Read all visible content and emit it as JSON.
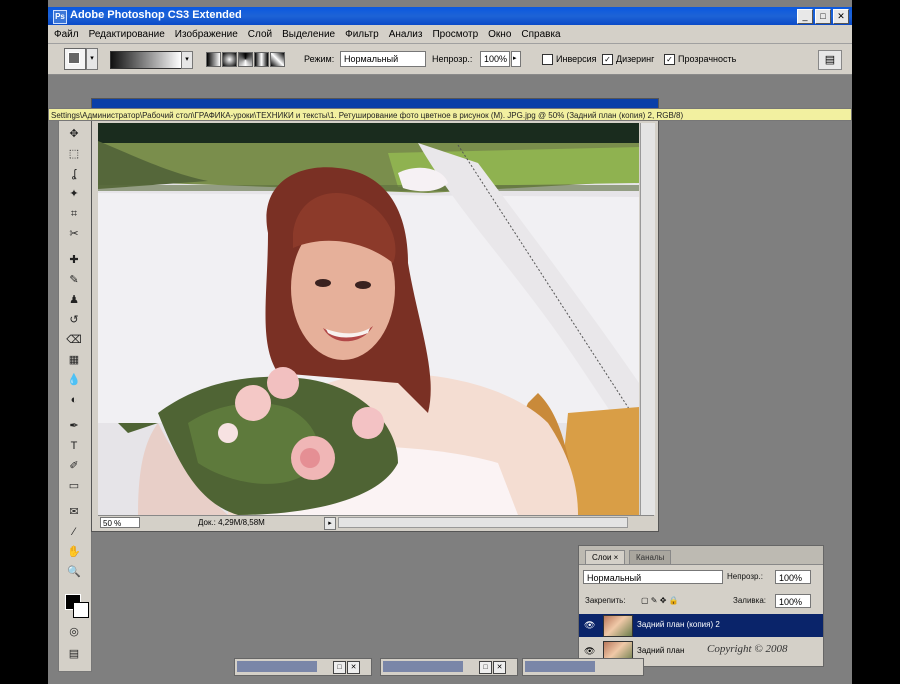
{
  "window": {
    "title": "Adobe Photoshop CS3 Extended",
    "app_icon": "Ps",
    "buttons": {
      "minimize": "_",
      "maximize": "□",
      "close": "✕"
    }
  },
  "menu": [
    "Файл",
    "Редактирование",
    "Изображение",
    "Слой",
    "Выделение",
    "Фильтр",
    "Анализ",
    "Просмотр",
    "Окно",
    "Справка"
  ],
  "options": {
    "mode_label": "Режим:",
    "mode_value": "Нормальный",
    "opacity_label": "Непрозр.:",
    "opacity_value": "100%",
    "inverse_label": "Инверсия",
    "dither_label": "Дизеринг",
    "transparency_label": "Прозрачность",
    "inverse_checked": "",
    "dither_checked": "✓",
    "transparency_checked": "✓",
    "check_mark": "✓"
  },
  "document": {
    "path": "Settings\\Администратор\\Рабочий стол\\ГРАФИКА-уроки\\ТЕХНИКИ и тексты\\1. Ретуширование фото цветное в рисунок (М). JPG.jpg @ 50% (Задний план (копия) 2, RGB/8)",
    "zoom": "50 %",
    "info": "Док.: 4,29M/8,58M"
  },
  "layers_panel": {
    "tabs": [
      "Слои ×",
      "Каналы"
    ],
    "blend_mode": "Нормальный",
    "opacity_label": "Непрозр.:",
    "opacity_value": "100%",
    "lock_label": "Закрепить:",
    "fill_label": "Заливка:",
    "fill_value": "100%",
    "layers": [
      {
        "name": "Задний план (копия) 2",
        "selected": true
      },
      {
        "name": "Задний план",
        "selected": false
      }
    ],
    "watermark": "Copyright © 2008"
  },
  "icons": {
    "move": "✥",
    "marquee": "⬚",
    "lasso": "ʆ",
    "magic_wand": "✦",
    "crop": "⌗",
    "slice": "✂",
    "heal": "✚",
    "brush": "✎",
    "stamp": "♟",
    "history": "↺",
    "eraser": "⌫",
    "gradient": "▦",
    "blur": "💧",
    "dodge": "◐",
    "path": "✒",
    "type": "T",
    "pen": "✐",
    "shape": "▭",
    "notes": "✉",
    "eyedropper": "⁄",
    "hand": "✋",
    "zoom": "🔍",
    "quickmask": "◎",
    "screen": "▤",
    "eye": "👁",
    "dropdown": "▾",
    "arrow_right": "▸"
  },
  "colors": {
    "accent": "#0a246a",
    "titlebar": "#0a58e0"
  }
}
